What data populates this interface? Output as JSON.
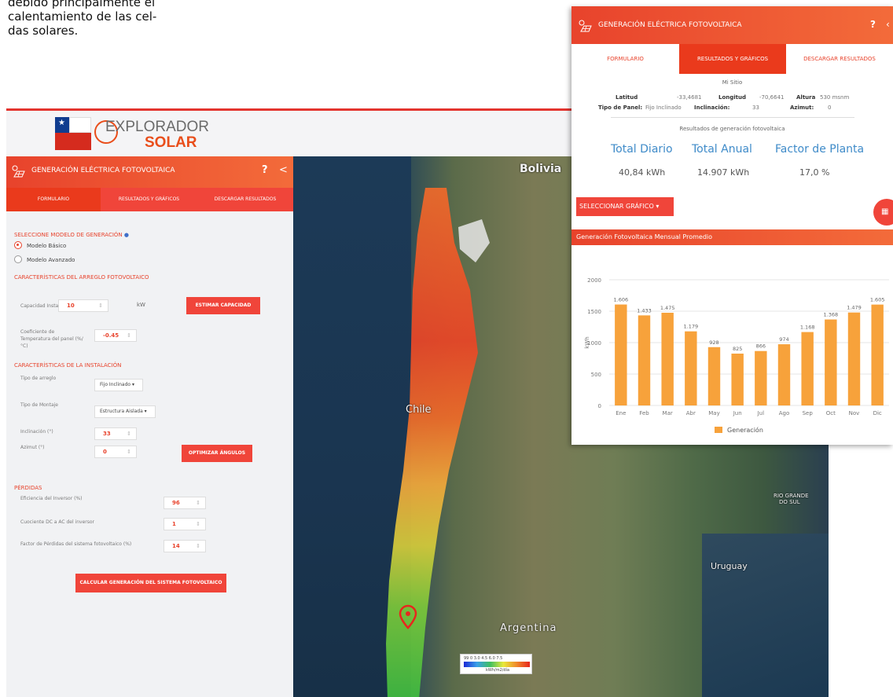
{
  "article": {
    "lines": [
      "debido principalmente el",
      "calentamiento de las cel-",
      "das solares."
    ]
  },
  "brand": {
    "name_line1": "EXPLORADOR",
    "name_line2": "SOLAR",
    "accent_color": "#e8432c"
  },
  "panel": {
    "title": "GENERACIÓN ELÉCTRICA FOTOVOLTAICA",
    "help": "?",
    "collapse": "<",
    "tabs": [
      "FORMULARIO",
      "RESULTADOS Y GRÁFICOS",
      "DESCARGAR RESULTADOS"
    ],
    "active_tab": 0,
    "model_heading": "SELECCIONE MODELO DE GENERACIÓN",
    "model_options": [
      "Modelo Básico",
      "Modelo Avanzado"
    ],
    "model_selected": 0,
    "array_heading": "CARACTERÍSTICAS DEL ARREGLO FOTOVOLTAICO",
    "capacity_label": "Capacidad Instalada",
    "capacity_value": "10",
    "capacity_unit": "kW",
    "estimate_button": "ESTIMAR CAPACIDAD",
    "temp_coef_label": "Coeficiente de Temperatura del panel (%/°C)",
    "temp_coef_value": "-0.45",
    "install_heading": "CARACTERÍSTICAS DE LA INSTALACIÓN",
    "array_type_label": "Tipo de arreglo",
    "array_type_value": "Fijo Inclinado ▾",
    "mount_label": "Tipo de Montaje",
    "mount_value": "Estructura Aislada ▾",
    "tilt_label": "Inclinación (°)",
    "tilt_value": "33",
    "azimuth_label": "Azimut (°)",
    "azimuth_value": "0",
    "optimize_button": "OPTIMIZAR ÁNGULOS",
    "losses_heading": "PÉRDIDAS",
    "inverter_eff_label": "Eficiencia del Inversor (%)",
    "inverter_eff_value": "96",
    "dc_ac_label": "Cuociente DC a AC del inversor",
    "dc_ac_value": "1",
    "loss_factor_label": "Factor de Pérdidas del sistema fotovoltaico (%)",
    "loss_factor_value": "14",
    "calc_button": "CALCULAR GENERACIÓN DEL SISTEMA FOTOVOLTAICO"
  },
  "map": {
    "places": {
      "bolivia": "Bolivia",
      "chile": "Chile",
      "argentina": "Argentina",
      "uruguay": "Uruguay",
      "rio_grande": "RIO GRANDE",
      "do_sul": "DO SUL"
    },
    "legend_values": "99  0  3.0  4.5  6.0  7.5",
    "legend_unit": "kWh/m2/día"
  },
  "results": {
    "title": "GENERACIÓN ELÉCTRICA FOTOVOLTAICA",
    "help": "?",
    "tabs": [
      "FORMULARIO",
      "RESULTADOS Y GRÁFICOS",
      "DESCARGAR RESULTADOS"
    ],
    "active_tab": 1,
    "site_name": "Mi Sitio",
    "lat_label": "Latitud",
    "lat_value": "-33,4681",
    "lon_label": "Longitud",
    "lon_value": "-70,6641",
    "alt_label": "Altura",
    "alt_value": "530 msnm",
    "panel_type_label": "Tipo de Panel:",
    "panel_type_value": "Fijo Inclinado",
    "tilt_label": "Inclinación:",
    "tilt_value": "33",
    "azimuth_label": "Azimut:",
    "azimuth_value": "0",
    "subtitle": "Resultados de generación fotovoltaica",
    "total_daily_label": "Total Diario",
    "total_daily_value": "40,84 kWh",
    "total_annual_label": "Total Anual",
    "total_annual_value": "14.907 kWh",
    "plant_factor_label": "Factor de Planta",
    "plant_factor_value": "17,0 %",
    "select_chart_button": "SELECCIONAR GRÁFICO ▾",
    "chart_heading": "Generación Fotovoltaica Mensual Promedio"
  },
  "chart_data": {
    "type": "bar",
    "categories": [
      "Ene",
      "Feb",
      "Mar",
      "Abr",
      "May",
      "Jun",
      "Jul",
      "Ago",
      "Sep",
      "Oct",
      "Nov",
      "Dic"
    ],
    "series": [
      {
        "name": "Generación",
        "values": [
          1606,
          1433,
          1475,
          1179,
          928,
          825,
          866,
          974,
          1168,
          1368,
          1479,
          1605
        ],
        "labels": [
          "1.606",
          "1.433",
          "1.475",
          "1.179",
          "928",
          "825",
          "866",
          "974",
          "1.168",
          "1.368",
          "1.479",
          "1.605"
        ],
        "color": "#f7a23b"
      }
    ],
    "ylabel": "kWh",
    "ylim": [
      0,
      2000
    ],
    "yticks": [
      0,
      500,
      1000,
      1500,
      2000
    ],
    "grid": true,
    "legend_position": "bottom"
  }
}
